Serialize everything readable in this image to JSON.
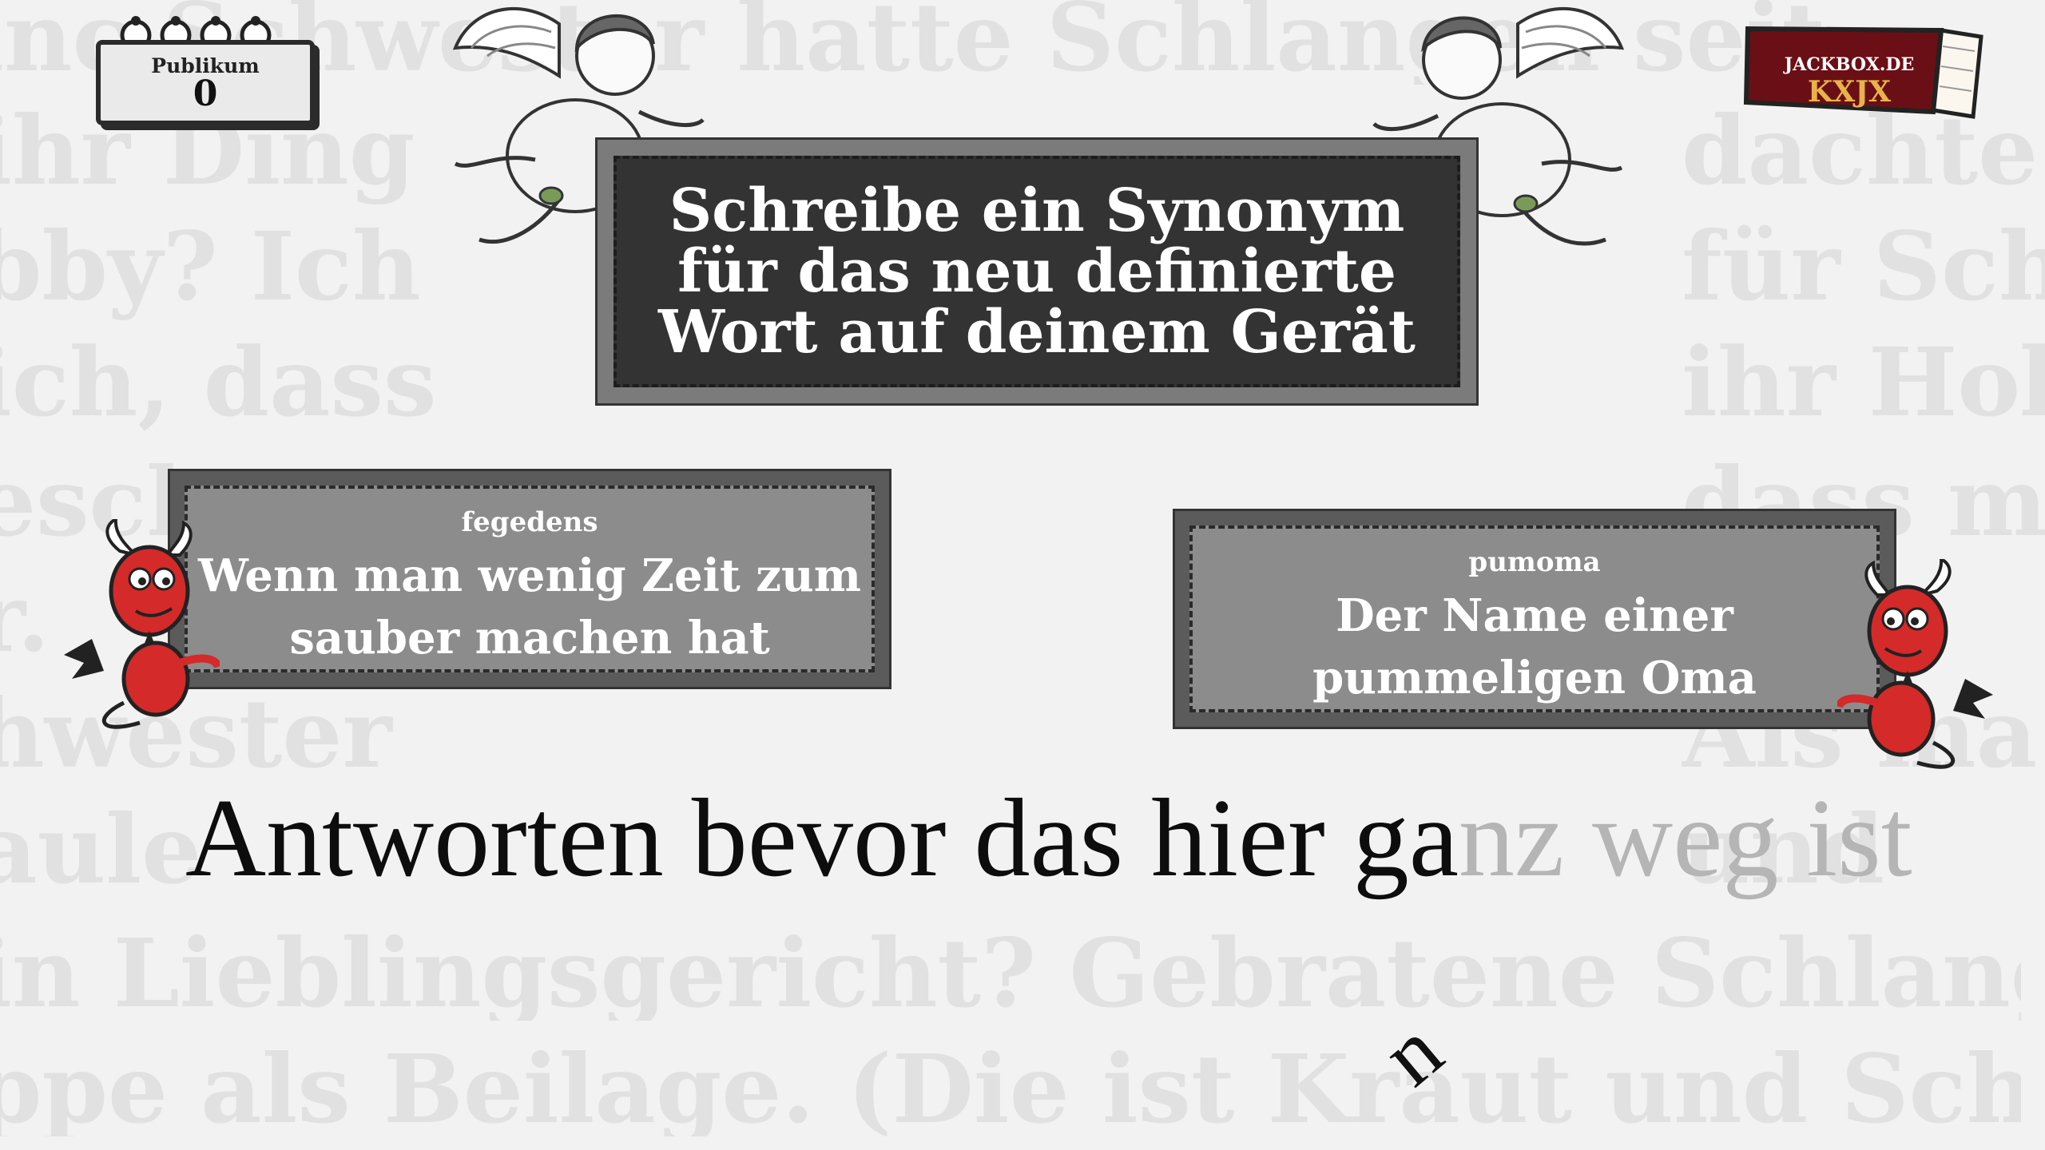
{
  "background_text": {
    "line1": "inc Schwester hatte Schlangen seit",
    "line2": "in Lieblingsgericht? Gebratene Schlangen",
    "line3": "ppe als Beilage. (Die ist Kraut und Schlang",
    "left_col": [
      "ihr Ding",
      "bby? Ich",
      "ich, dass",
      "esch",
      "r.",
      "hwester",
      "aule"
    ],
    "right_col": [
      "dachte",
      "für Sch",
      "ihr Hob",
      "dass me",
      "Als ma",
      "und"
    ]
  },
  "audience": {
    "label": "Publikum",
    "count": "0"
  },
  "room": {
    "site": "JACKBOX.DE",
    "code": "KXJX"
  },
  "prompt": {
    "text": "Schreibe ein Synonym\nfür das neu definierte\nWort auf deinem Gerät"
  },
  "cards": [
    {
      "word": "fegedens",
      "definition": "Wenn man wenig Zeit zum sauber machen hat"
    },
    {
      "word": "pumoma",
      "definition": "Der Name einer pummeligen Oma"
    }
  ],
  "timer_sentence": {
    "typed": "Antworten bevor das hier ga",
    "remaining": "nz weg ist"
  },
  "falling_letter": "n",
  "colors": {
    "panel_dark": "#333333",
    "card_gray": "#8c8c8c",
    "devil_red": "#d42a2a",
    "book_red": "#6a0f16",
    "book_gold": "#e8b34a"
  },
  "icons": [
    "cherub-icon",
    "devil-icon",
    "book-icon"
  ]
}
